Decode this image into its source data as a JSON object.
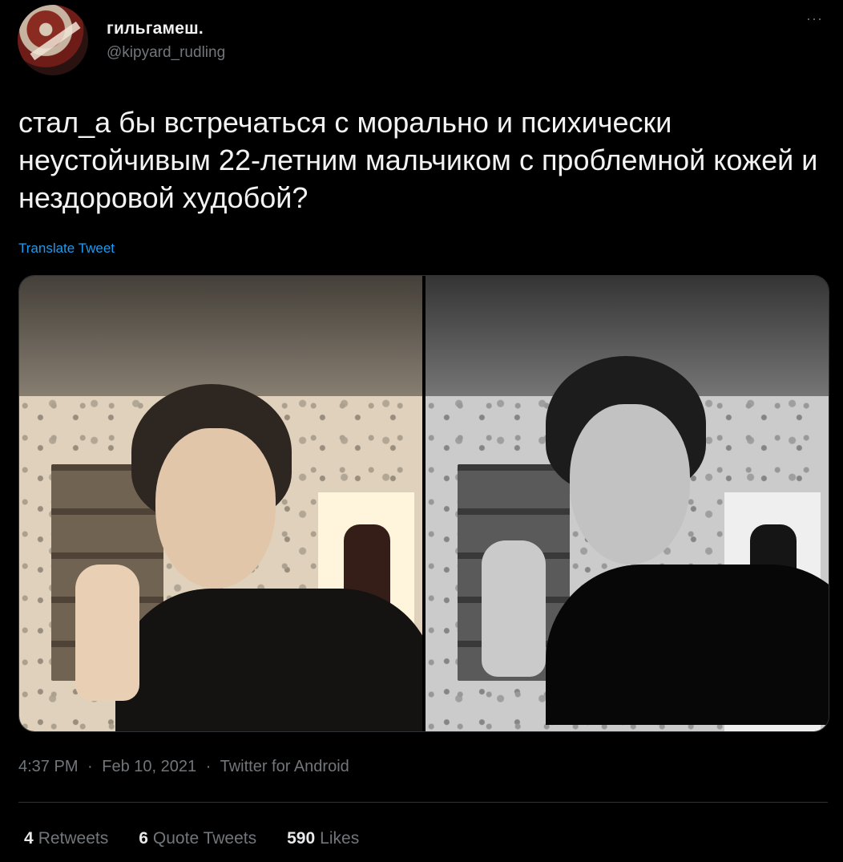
{
  "author": {
    "display_name": "гильгамеш.",
    "handle": "@kipyard_rudling"
  },
  "tweet": {
    "text": "стал_а бы встречаться с морально и психически неустойчивым 22-летним мальчиком с проблемной кожей и нездоровой худобой?",
    "translate_label": "Translate Tweet"
  },
  "meta": {
    "time": "4:37 PM",
    "date": "Feb 10, 2021",
    "source": "Twitter for Android",
    "separator": "·"
  },
  "stats": {
    "retweets_count": "4",
    "retweets_label": "Retweets",
    "quotes_count": "6",
    "quotes_label": "Quote Tweets",
    "likes_count": "590",
    "likes_label": "Likes"
  },
  "icons": {
    "more": "more-horizontal-icon"
  },
  "colors": {
    "background": "#000000",
    "text": "#e7e9ea",
    "secondary": "#71767b",
    "link": "#1d9bf0"
  }
}
